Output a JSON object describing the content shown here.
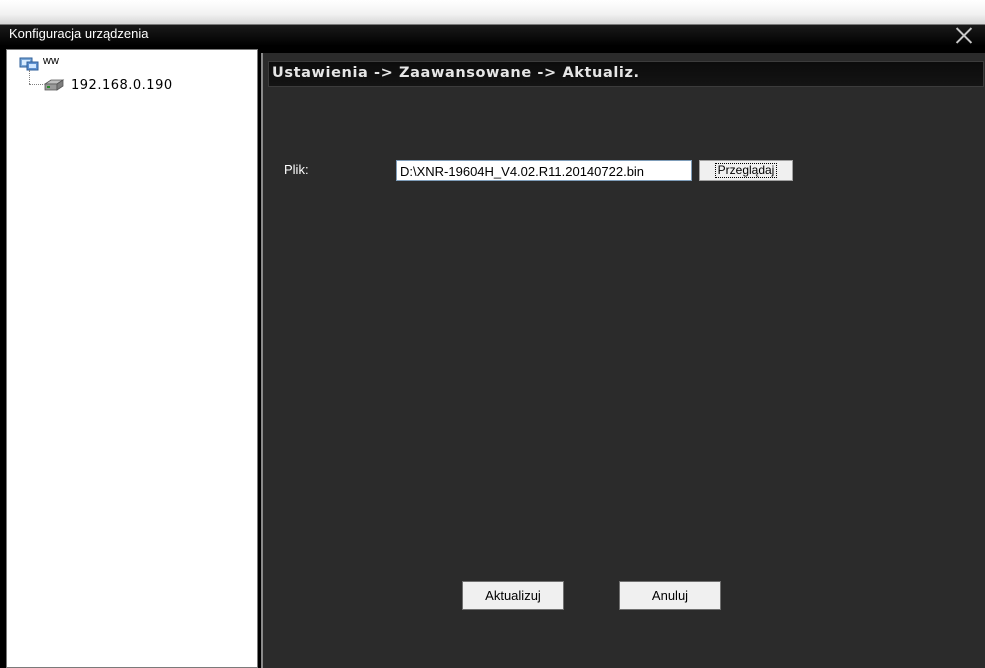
{
  "window": {
    "title": "Konfiguracja urządzenia"
  },
  "tree": {
    "root_label": "ww",
    "device_label": "192.168.0.190"
  },
  "panel": {
    "breadcrumb": "Ustawienia -> Zaawansowane -> Aktualiz."
  },
  "form": {
    "file_label": "Plik:",
    "file_value": "D:\\XNR-19604H_V4.02.R11.20140722.bin",
    "browse_label": "Przeglądaj"
  },
  "actions": {
    "update_label": "Aktualizuj",
    "cancel_label": "Anuluj"
  }
}
